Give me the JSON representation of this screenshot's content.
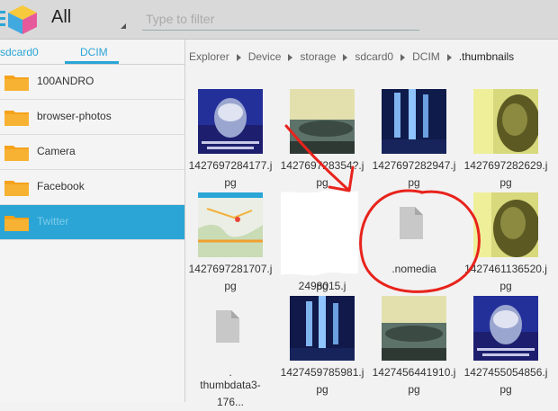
{
  "header": {
    "title": "All",
    "filter_placeholder": "Type to filter"
  },
  "sidebar": {
    "tabs": [
      {
        "label": "sdcard0"
      },
      {
        "label": "DCIM"
      }
    ],
    "folders": [
      {
        "label": "100ANDRO"
      },
      {
        "label": "browser-photos"
      },
      {
        "label": "Camera"
      },
      {
        "label": "Facebook"
      },
      {
        "label": "Twitter"
      }
    ]
  },
  "breadcrumb": [
    "Explorer",
    "Device",
    "storage",
    "sdcard0",
    "DCIM",
    ".thumbnails"
  ],
  "files": [
    {
      "line1": "1427697284177.j",
      "line2": "pg"
    },
    {
      "line1": "142769728354?.j",
      "line2": "pg"
    },
    {
      "line1": "1427697282947.j",
      "line2": "pg"
    },
    {
      "line1": "1427697282629.j",
      "line2": "pg"
    },
    {
      "line1": "1427697281707.j",
      "line2": "pg"
    },
    {
      "line1": "142769?2498015.j",
      "line2": "pg"
    },
    {
      "line1": ".nomedia",
      "line2": ""
    },
    {
      "line1": "1427461136520.j",
      "line2": "pg"
    },
    {
      "line1": ".",
      "line2": "thumbdata3-176..."
    },
    {
      "line1": "1427459785981.j",
      "line2": "pg"
    },
    {
      "line1": "1427456441910.j",
      "line2": "pg"
    },
    {
      "line1": "1427455054856.j",
      "line2": "pg"
    }
  ],
  "colors": {
    "accent": "#2aa5d6",
    "folder": "#f5a21b",
    "annotation": "#e8231c"
  }
}
